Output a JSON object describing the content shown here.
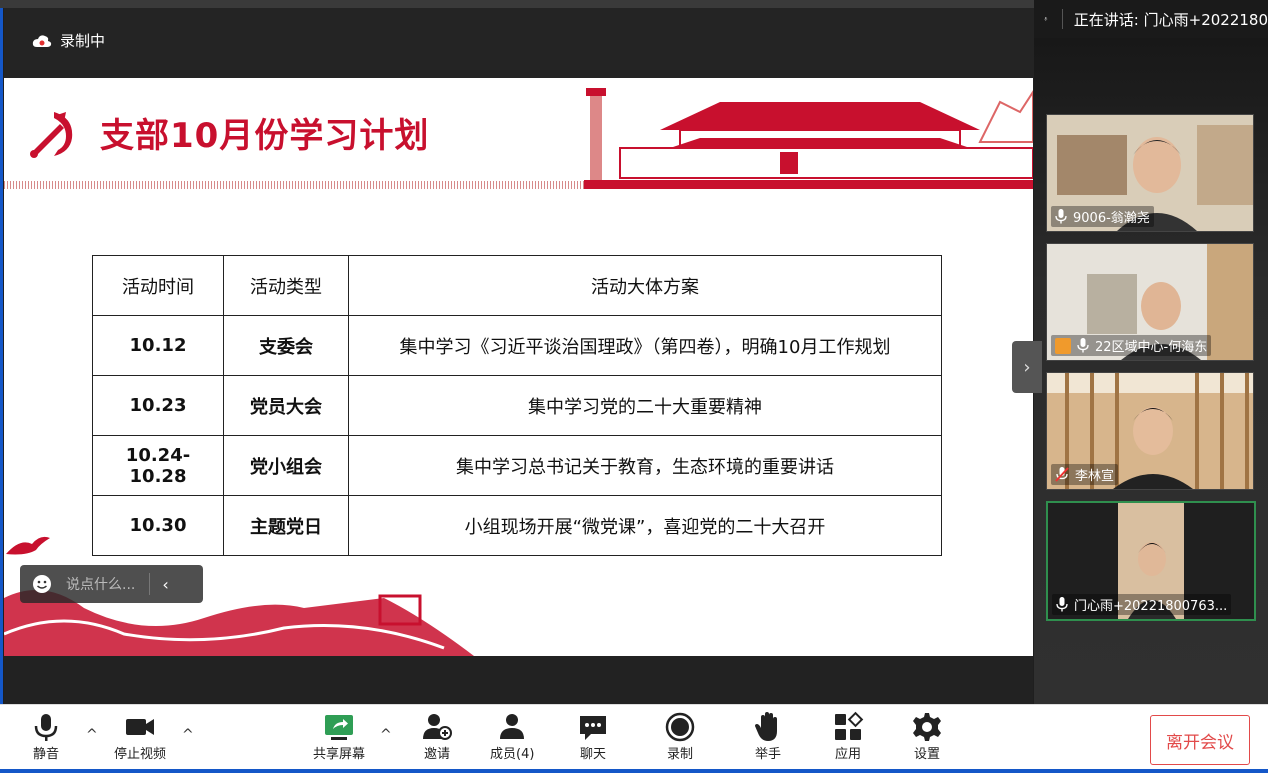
{
  "recording": {
    "label": "录制中"
  },
  "slide": {
    "title": "支部10月份学习计划",
    "table": {
      "headers": [
        "活动时间",
        "活动类型",
        "活动大体方案"
      ],
      "rows": [
        [
          "10.12",
          "支委会",
          "集中学习《习近平谈治国理政》（第四卷），明确10月工作规划"
        ],
        [
          "10.23",
          "党员大会",
          "集中学习党的二十大重要精神"
        ],
        [
          "10.24-10.28",
          "党小组会",
          "集中学习总书记关于教育，生态环境的重要讲话"
        ],
        [
          "10.30",
          "主题党日",
          "小组现场开展“微党课”，喜迎党的二十大召开"
        ]
      ]
    }
  },
  "chat": {
    "placeholder": "说点什么..."
  },
  "speaking": {
    "label": "正在讲话: 门心雨+2022180"
  },
  "participants": [
    {
      "name": "9006-翁瀚尧",
      "mic": "on"
    },
    {
      "name": "22区域中心-何海东",
      "mic": "on"
    },
    {
      "name": "李林宣",
      "mic": "muted"
    },
    {
      "name": "门心雨+20221800763...",
      "mic": "on"
    }
  ],
  "toolbar": {
    "mute": "静音",
    "stop_video": "停止视频",
    "share": "共享屏幕",
    "invite": "邀请",
    "members": "成员(4)",
    "chat": "聊天",
    "record": "录制",
    "raise_hand": "举手",
    "apps": "应用",
    "settings": "设置",
    "leave": "离开会议"
  },
  "colors": {
    "accent_red": "#c8102e",
    "share_green": "#2f9e55",
    "leave_red": "#e24a4a"
  }
}
